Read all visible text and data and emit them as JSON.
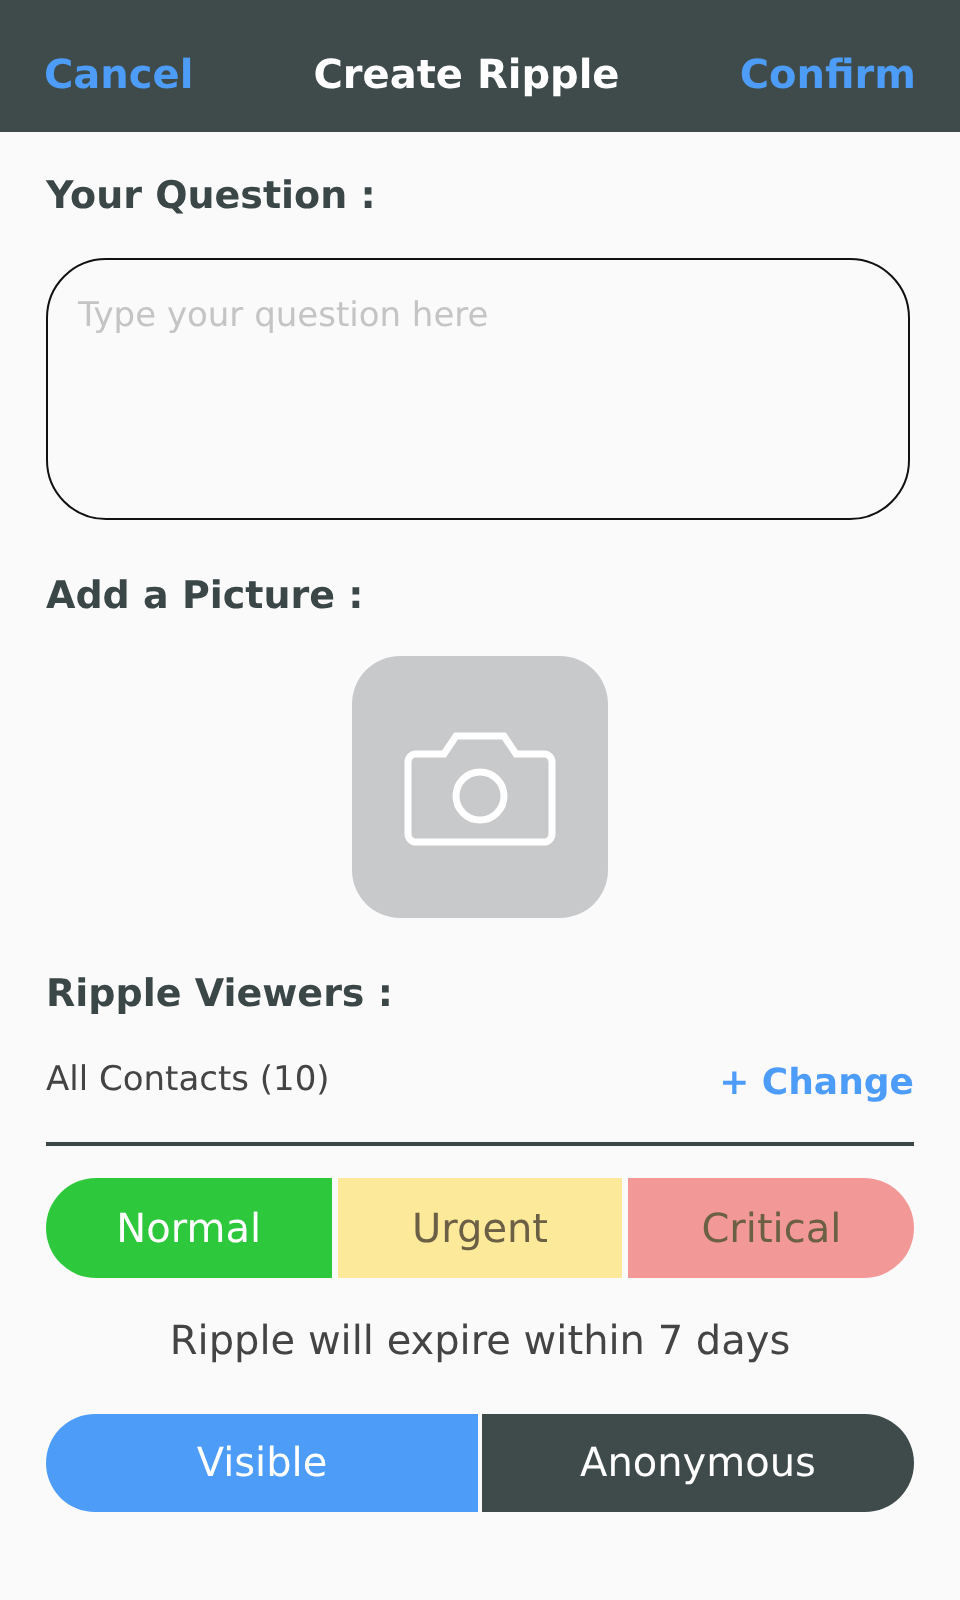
{
  "header": {
    "cancel": "Cancel",
    "title": "Create Ripple",
    "confirm": "Confirm"
  },
  "question": {
    "label": "Your Question :",
    "placeholder": "Type your question here"
  },
  "picture": {
    "label": "Add a Picture :"
  },
  "viewers": {
    "label": "Ripple Viewers :",
    "value": "All Contacts (10)",
    "change": "+ Change"
  },
  "priority": [
    {
      "label": "Normal",
      "selected": true,
      "color": "#2ec83c"
    },
    {
      "label": "Urgent",
      "selected": false,
      "color": "#fde99a"
    },
    {
      "label": "Critical",
      "selected": false,
      "color": "#f29896"
    }
  ],
  "expiry": "Ripple will expire within 7 days",
  "visibility": [
    {
      "label": "Visible",
      "selected": true
    },
    {
      "label": "Anonymous",
      "selected": false
    }
  ]
}
